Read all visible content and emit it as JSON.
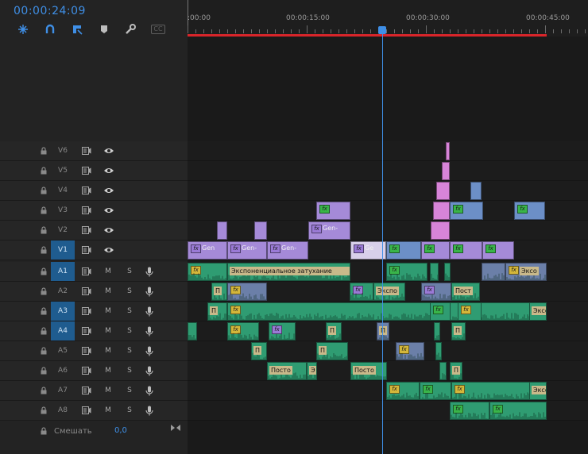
{
  "timecode": "00:00:24:09",
  "toolbar": [
    {
      "name": "snap-icon"
    },
    {
      "name": "linked-selection-icon"
    },
    {
      "name": "add-marker-icon"
    },
    {
      "name": "marker-icon"
    },
    {
      "name": "wrench-icon"
    },
    {
      "name": "captions-icon",
      "label": "CC"
    }
  ],
  "ruler": {
    "labels": [
      ":00:00",
      "00:00:15:00",
      "00:00:30:00",
      "00:00:45:00"
    ]
  },
  "video_tracks": [
    {
      "label": "V6",
      "selected": false
    },
    {
      "label": "V5",
      "selected": false
    },
    {
      "label": "V4",
      "selected": false
    },
    {
      "label": "V3",
      "selected": false
    },
    {
      "label": "V2",
      "selected": false
    },
    {
      "label": "V1",
      "selected": true
    }
  ],
  "audio_tracks": [
    {
      "label": "A1",
      "selected": true,
      "m": "M",
      "s": "S"
    },
    {
      "label": "A2",
      "selected": false,
      "m": "M",
      "s": "S"
    },
    {
      "label": "A3",
      "selected": true,
      "m": "M",
      "s": "S"
    },
    {
      "label": "A4",
      "selected": true,
      "m": "M",
      "s": "S"
    },
    {
      "label": "A5",
      "selected": false,
      "m": "M",
      "s": "S"
    },
    {
      "label": "A6",
      "selected": false,
      "m": "M",
      "s": "S"
    },
    {
      "label": "A7",
      "selected": false,
      "m": "M",
      "s": "S"
    },
    {
      "label": "A8",
      "selected": false,
      "m": "M",
      "s": "S"
    }
  ],
  "mix": {
    "label": "Смешать",
    "value": "0,0"
  },
  "fx_badge": "fx",
  "clip_names": {
    "gen": "Gen",
    "gen_dash": "Gen-",
    "ge": "Ge",
    "exp_fade": "Экспоненциальное затухание",
    "expo": "Экспо",
    "eks": "Эксо",
    "e": "Э",
    "post": "Пост",
    "posto": "Посто",
    "p": "П"
  },
  "colors": {
    "accent": "#3f8fe6",
    "work_area": "#d9252a",
    "video_clip": "#a58ad8",
    "video_blue": "#6c8fc7",
    "video_pink": "#d784d8",
    "audio_clip": "#2f9c72",
    "audio_blue": "#6b7fa8",
    "fx_green": "#39b54a",
    "fx_yellow": "#d4b73a",
    "fx_purple": "#9a7ad6"
  }
}
